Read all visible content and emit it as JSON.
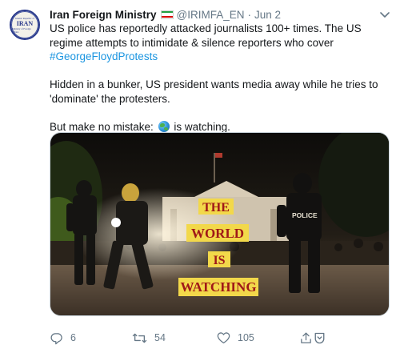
{
  "account": {
    "display_name": "Iran Foreign Ministry",
    "flag_icon": "iran-flag-icon",
    "handle": "@IRIMFA_EN",
    "separator": "·",
    "date": "Jun 2",
    "avatar": {
      "small_text": "Islamic Republic of",
      "main_text": "IRAN",
      "sub_text": "Ministry of Foreign Affairs",
      "color": "#2a3a8c"
    }
  },
  "tweet": {
    "line1": "US police has reportedly attacked journalists 100+ times. The US regime attempts to intimidate & silence reporters who cover",
    "hashtag": "#GeorgeFloydProtests",
    "hashtag_color": "#1b95e0",
    "paragraph2": "Hidden in a bunker, US president wants media away while he tries to 'dominate' the protesters.",
    "paragraph3_before": "But make no mistake:",
    "paragraph3_emoji": "globe-icon",
    "paragraph3_after": "is watching."
  },
  "media": {
    "overlay_words": [
      "THE",
      "WORLD",
      "IS",
      "WATCHING"
    ],
    "overlay_bg": "#f2d84a",
    "overlay_text_color": "#a01818",
    "police_label": "POLICE"
  },
  "actions": {
    "reply_count": "6",
    "retweet_count": "54",
    "like_count": "105",
    "icon_color": "#657786"
  }
}
